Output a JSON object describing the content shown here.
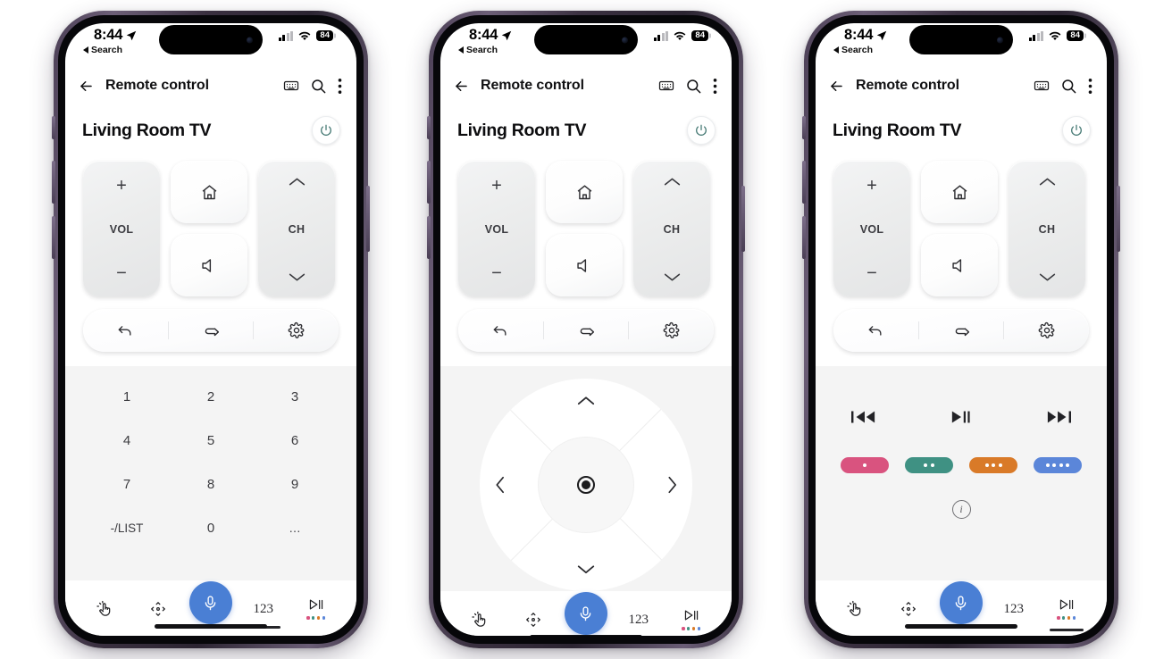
{
  "status_bar": {
    "time": "8:44",
    "back_label": "Search",
    "battery": "84",
    "location_icon": "location-arrow-icon",
    "signal_icon": "cellular-bars-icon",
    "wifi_icon": "wifi-icon"
  },
  "app_bar": {
    "back_icon": "back-arrow-icon",
    "title": "Remote control",
    "keyboard_icon": "keyboard-icon",
    "search_icon": "search-icon",
    "overflow_icon": "more-vertical-icon"
  },
  "device": {
    "name": "Living Room TV",
    "power_icon": "power-icon",
    "power_color": "#4e7f7a"
  },
  "controls": {
    "volume": {
      "label": "VOL",
      "up": "+",
      "down": "−",
      "name": "volume-rocker"
    },
    "channel": {
      "label": "CH",
      "up_icon": "chevron-up-icon",
      "down_icon": "chevron-down-icon",
      "name": "channel-rocker"
    },
    "home_icon": "home-icon",
    "mute_icon": "mute-speaker-icon",
    "quickbar": [
      {
        "icon": "back-undo-icon",
        "name": "back-button"
      },
      {
        "icon": "input-source-icon",
        "name": "input-source-button"
      },
      {
        "icon": "gear-icon",
        "name": "settings-button"
      }
    ]
  },
  "keypad": {
    "keys": [
      "1",
      "2",
      "3",
      "4",
      "5",
      "6",
      "7",
      "8",
      "9",
      "-/LIST",
      "0",
      "…"
    ]
  },
  "dpad": {
    "up_icon": "chevron-up-icon",
    "down_icon": "chevron-down-icon",
    "left_icon": "chevron-left-icon",
    "right_icon": "chevron-right-icon",
    "ok_icon": "ok-center-icon"
  },
  "media": {
    "transport": [
      {
        "icon": "rewind-icon",
        "name": "rewind-button"
      },
      {
        "icon": "play-pause-icon",
        "name": "play-pause-button"
      },
      {
        "icon": "fast-forward-icon",
        "name": "fast-forward-button"
      }
    ],
    "color_buttons": [
      {
        "name": "color-button-red",
        "color": "#d9537f",
        "dots": 1
      },
      {
        "name": "color-button-green",
        "color": "#3f9183",
        "dots": 2
      },
      {
        "name": "color-button-yellow",
        "color": "#d97a28",
        "dots": 3
      },
      {
        "name": "color-button-blue",
        "color": "#5b86d9",
        "dots": 4
      }
    ],
    "info_icon": "info-icon",
    "info_label": "i"
  },
  "bottom_nav": {
    "touchpad_icon": "touchpad-gesture-icon",
    "dpad_icon": "dpad-icon",
    "mic_icon": "microphone-icon",
    "numbers_label": "123",
    "media_icon": "media-play-pause-icon",
    "media_dot_colors": [
      "#d9537f",
      "#3f9183",
      "#d97a28",
      "#5b86d9"
    ]
  },
  "phones": [
    {
      "name": "phone-keypad-view",
      "active_tab": "numbers"
    },
    {
      "name": "phone-dpad-view",
      "active_tab": "dpad"
    },
    {
      "name": "phone-media-view",
      "active_tab": "media"
    }
  ]
}
